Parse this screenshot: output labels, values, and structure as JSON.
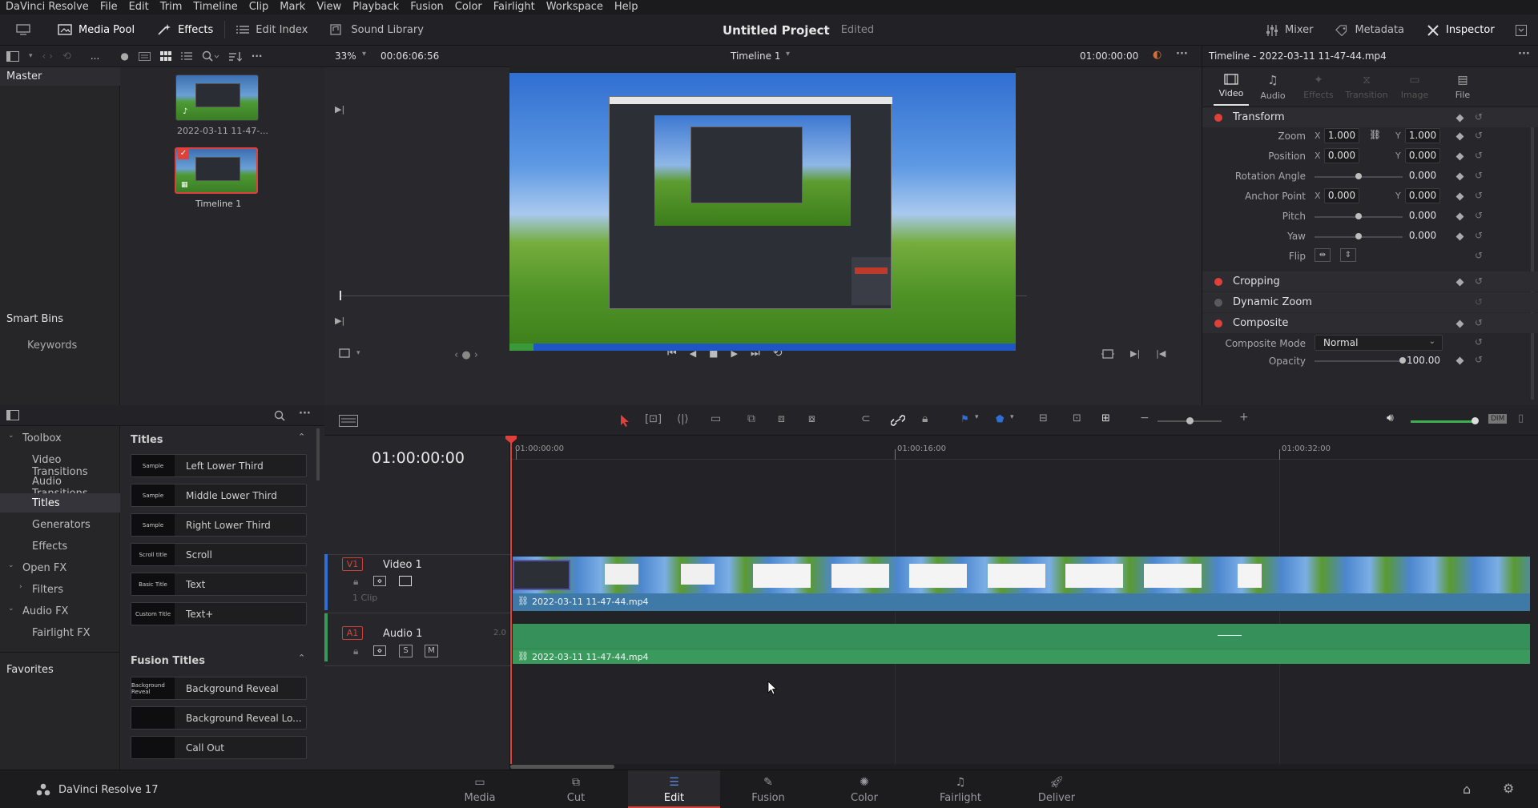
{
  "menu": [
    "DaVinci Resolve",
    "File",
    "Edit",
    "Trim",
    "Timeline",
    "Clip",
    "Mark",
    "View",
    "Playback",
    "Fusion",
    "Color",
    "Fairlight",
    "Workspace",
    "Help"
  ],
  "toolbar": {
    "media_pool": "Media Pool",
    "effects": "Effects",
    "edit_index": "Edit Index",
    "sound_library": "Sound Library",
    "project_title": "Untitled Project",
    "project_status": "Edited",
    "mixer": "Mixer",
    "metadata": "Metadata",
    "inspector": "Inspector"
  },
  "media_pool": {
    "more": "...",
    "master": "Master",
    "smart_bins": "Smart Bins",
    "keywords": "Keywords",
    "clips": [
      {
        "name": "2022-03-11 11-47-..."
      },
      {
        "name": "Timeline 1"
      }
    ]
  },
  "viewer": {
    "zoom": "33%",
    "duration": "00:06:06:56",
    "timeline_name": "Timeline 1",
    "timecode": "01:00:00:00"
  },
  "inspector": {
    "header": "Timeline - 2022-03-11 11-47-44.mp4",
    "tabs": [
      "Video",
      "Audio",
      "Effects",
      "Transition",
      "Image",
      "File"
    ],
    "transform": "Transform",
    "zoom_label": "Zoom",
    "zoom_x": "1.000",
    "zoom_y": "1.000",
    "position_label": "Position",
    "position_x": "0.000",
    "position_y": "0.000",
    "rotation_label": "Rotation Angle",
    "rotation": "0.000",
    "anchor_label": "Anchor Point",
    "anchor_x": "0.000",
    "anchor_y": "0.000",
    "pitch_label": "Pitch",
    "pitch": "0.000",
    "yaw_label": "Yaw",
    "yaw": "0.000",
    "flip_label": "Flip",
    "x": "X",
    "y": "Y",
    "cropping": "Cropping",
    "dynamic_zoom": "Dynamic Zoom",
    "composite": "Composite",
    "composite_mode_label": "Composite Mode",
    "composite_mode": "Normal",
    "opacity_label": "Opacity",
    "opacity": "100.00",
    "rotation_level": 0.5,
    "pitch_level": 0.5,
    "yaw_level": 0.5,
    "opacity_level": 1.0
  },
  "effects": {
    "tree": {
      "toolbox": "Toolbox",
      "video_transitions": "Video Transitions",
      "audio_transitions": "Audio Transitions",
      "titles": "Titles",
      "generators": "Generators",
      "effects": "Effects",
      "open_fx": "Open FX",
      "filters": "Filters",
      "audio_fx": "Audio FX",
      "fairlight_fx": "Fairlight FX",
      "favorites": "Favorites"
    },
    "titles_header": "Titles",
    "titles": [
      {
        "name": "Left Lower Third",
        "preview": "Sample"
      },
      {
        "name": "Middle Lower Third",
        "preview": "Sample"
      },
      {
        "name": "Right Lower Third",
        "preview": "Sample"
      },
      {
        "name": "Scroll",
        "preview": "Scroll title"
      },
      {
        "name": "Text",
        "preview": "Basic Title"
      },
      {
        "name": "Text+",
        "preview": "Custom Title"
      }
    ],
    "fusion_header": "Fusion Titles",
    "fusion_titles": [
      {
        "name": "Background Reveal",
        "preview": "Background Reveal"
      },
      {
        "name": "Background Reveal Lo...",
        "preview": ""
      },
      {
        "name": "Call Out",
        "preview": ""
      }
    ]
  },
  "timeline": {
    "timecode": "01:00:00:00",
    "ruler": [
      "01:00:00:00",
      "01:00:16:00",
      "01:00:32:00"
    ],
    "video_track": {
      "tag": "V1",
      "name": "Video 1",
      "clips": "1 Clip",
      "clip_name": "2022-03-11 11-47-44.mp4"
    },
    "audio_track": {
      "tag": "A1",
      "name": "Audio 1",
      "level": "2.0",
      "solo": "S",
      "mute": "M",
      "clip_name": "2022-03-11 11-47-44.mp4"
    },
    "dim": "DIM"
  },
  "pages": [
    "Media",
    "Cut",
    "Edit",
    "Fusion",
    "Color",
    "Fairlight",
    "Deliver"
  ],
  "active_page": "Edit",
  "product": "DaVinci Resolve 17",
  "colors": {
    "accent_red": "#e0403a",
    "video_clip": "#3f79a8",
    "audio_clip": "#3a9a5e"
  }
}
